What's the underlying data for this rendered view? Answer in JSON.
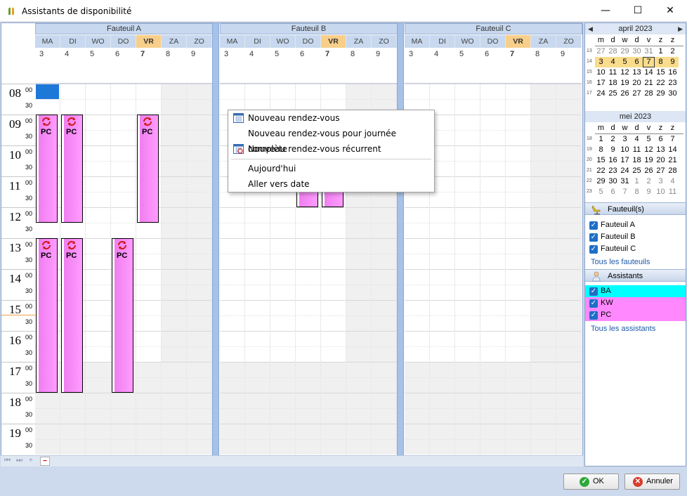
{
  "window": {
    "title": "Assistants de disponibilité",
    "minimize": "—",
    "maximize": "☐",
    "close": "✕"
  },
  "resources": [
    {
      "name": "Fauteuil A"
    },
    {
      "name": "Fauteuil B"
    },
    {
      "name": "Fauteuil C"
    }
  ],
  "days": [
    {
      "abbr": "MA",
      "num": "3",
      "today": false,
      "weekend": false
    },
    {
      "abbr": "DI",
      "num": "4",
      "today": false,
      "weekend": false
    },
    {
      "abbr": "WO",
      "num": "5",
      "today": false,
      "weekend": false
    },
    {
      "abbr": "DO",
      "num": "6",
      "today": false,
      "weekend": false
    },
    {
      "abbr": "VR",
      "num": "7",
      "today": true,
      "weekend": false
    },
    {
      "abbr": "ZA",
      "num": "8",
      "today": false,
      "weekend": true
    },
    {
      "abbr": "ZO",
      "num": "9",
      "today": false,
      "weekend": true
    }
  ],
  "hours": [
    {
      "h": "08",
      "m1": "00",
      "m2": "30"
    },
    {
      "h": "09",
      "m1": "00",
      "m2": "30"
    },
    {
      "h": "10",
      "m1": "00",
      "m2": "30"
    },
    {
      "h": "11",
      "m1": "00",
      "m2": "30"
    },
    {
      "h": "12",
      "m1": "00",
      "m2": "30"
    },
    {
      "h": "13",
      "m1": "00",
      "m2": "30"
    },
    {
      "h": "14",
      "m1": "00",
      "m2": "30"
    },
    {
      "h": "15",
      "m1": "00",
      "m2": "30"
    },
    {
      "h": "16",
      "m1": "00",
      "m2": "30"
    },
    {
      "h": "17",
      "m1": "00",
      "m2": "30"
    },
    {
      "h": "18",
      "m1": "00",
      "m2": "30"
    },
    {
      "h": "19",
      "m1": "00",
      "m2": "30"
    }
  ],
  "appointments": [
    {
      "resource": 0,
      "day": 0,
      "start": "09:00",
      "end": "12:30",
      "label": "PC"
    },
    {
      "resource": 0,
      "day": 1,
      "start": "09:00",
      "end": "12:30",
      "label": "PC"
    },
    {
      "resource": 0,
      "day": 4,
      "start": "09:00",
      "end": "12:30",
      "label": "PC"
    },
    {
      "resource": 0,
      "day": 0,
      "start": "13:00",
      "end": "18:00",
      "label": "PC"
    },
    {
      "resource": 0,
      "day": 1,
      "start": "13:00",
      "end": "18:00",
      "label": "PC"
    },
    {
      "resource": 0,
      "day": 3,
      "start": "13:00",
      "end": "18:00",
      "label": "PC"
    },
    {
      "resource": 1,
      "day": 3,
      "start": "11:00",
      "end": "12:00",
      "label": ""
    },
    {
      "resource": 1,
      "day": 4,
      "start": "11:00",
      "end": "12:00",
      "label": ""
    }
  ],
  "context_menu": {
    "items": [
      {
        "label": "Nouveau rendez-vous",
        "icon": "calendar-icon"
      },
      {
        "label": "Nouveau rendez-vous pour journée complète",
        "icon": ""
      },
      {
        "label": "Nouveau rendez-vous récurrent",
        "icon": "recurring-calendar-icon"
      },
      {
        "label": "Aujourd'hui",
        "icon": ""
      },
      {
        "label": "Aller vers date",
        "icon": ""
      }
    ]
  },
  "mini_calendars": [
    {
      "month": "april 2023",
      "weekdays": [
        "m",
        "d",
        "w",
        "d",
        "v",
        "z",
        "z"
      ],
      "weeks": [
        {
          "wk": "13",
          "days": [
            "27",
            "28",
            "29",
            "30",
            "31",
            "1",
            "2"
          ]
        },
        {
          "wk": "14",
          "days": [
            "3",
            "4",
            "5",
            "6",
            "7",
            "8",
            "9"
          ]
        },
        {
          "wk": "15",
          "days": [
            "10",
            "11",
            "12",
            "13",
            "14",
            "15",
            "16"
          ]
        },
        {
          "wk": "16",
          "days": [
            "17",
            "18",
            "19",
            "20",
            "21",
            "22",
            "23"
          ]
        },
        {
          "wk": "17",
          "days": [
            "24",
            "25",
            "26",
            "27",
            "28",
            "29",
            "30"
          ]
        }
      ]
    },
    {
      "month": "mei 2023",
      "weekdays": [
        "m",
        "d",
        "w",
        "d",
        "v",
        "z",
        "z"
      ],
      "weeks": [
        {
          "wk": "18",
          "days": [
            "1",
            "2",
            "3",
            "4",
            "5",
            "6",
            "7"
          ]
        },
        {
          "wk": "19",
          "days": [
            "8",
            "9",
            "10",
            "11",
            "12",
            "13",
            "14"
          ]
        },
        {
          "wk": "20",
          "days": [
            "15",
            "16",
            "17",
            "18",
            "19",
            "20",
            "21"
          ]
        },
        {
          "wk": "21",
          "days": [
            "22",
            "23",
            "24",
            "25",
            "26",
            "27",
            "28"
          ]
        },
        {
          "wk": "22",
          "days": [
            "29",
            "30",
            "31",
            "1",
            "2",
            "3",
            "4"
          ]
        },
        {
          "wk": "23",
          "days": [
            "5",
            "6",
            "7",
            "8",
            "9",
            "10",
            "11"
          ]
        }
      ]
    }
  ],
  "fauteuils_panel": {
    "title": "Fauteuil(s)",
    "items": [
      "Fauteuil A",
      "Fauteuil B",
      "Fauteuil C"
    ],
    "link": "Tous les fauteuils"
  },
  "assistants_panel": {
    "title": "Assistants",
    "items": [
      {
        "label": "BA",
        "color": "#00ffff"
      },
      {
        "label": "KW",
        "color": "#ff88ff"
      },
      {
        "label": "PC",
        "color": "#ff88ff"
      }
    ],
    "link": "Tous les assistants"
  },
  "buttons": {
    "ok": "OK",
    "cancel": "Annuler"
  },
  "colors": {
    "today_header": "#f8cf8a",
    "appointment": "#ff88ff",
    "selection": "#1e78d8"
  }
}
